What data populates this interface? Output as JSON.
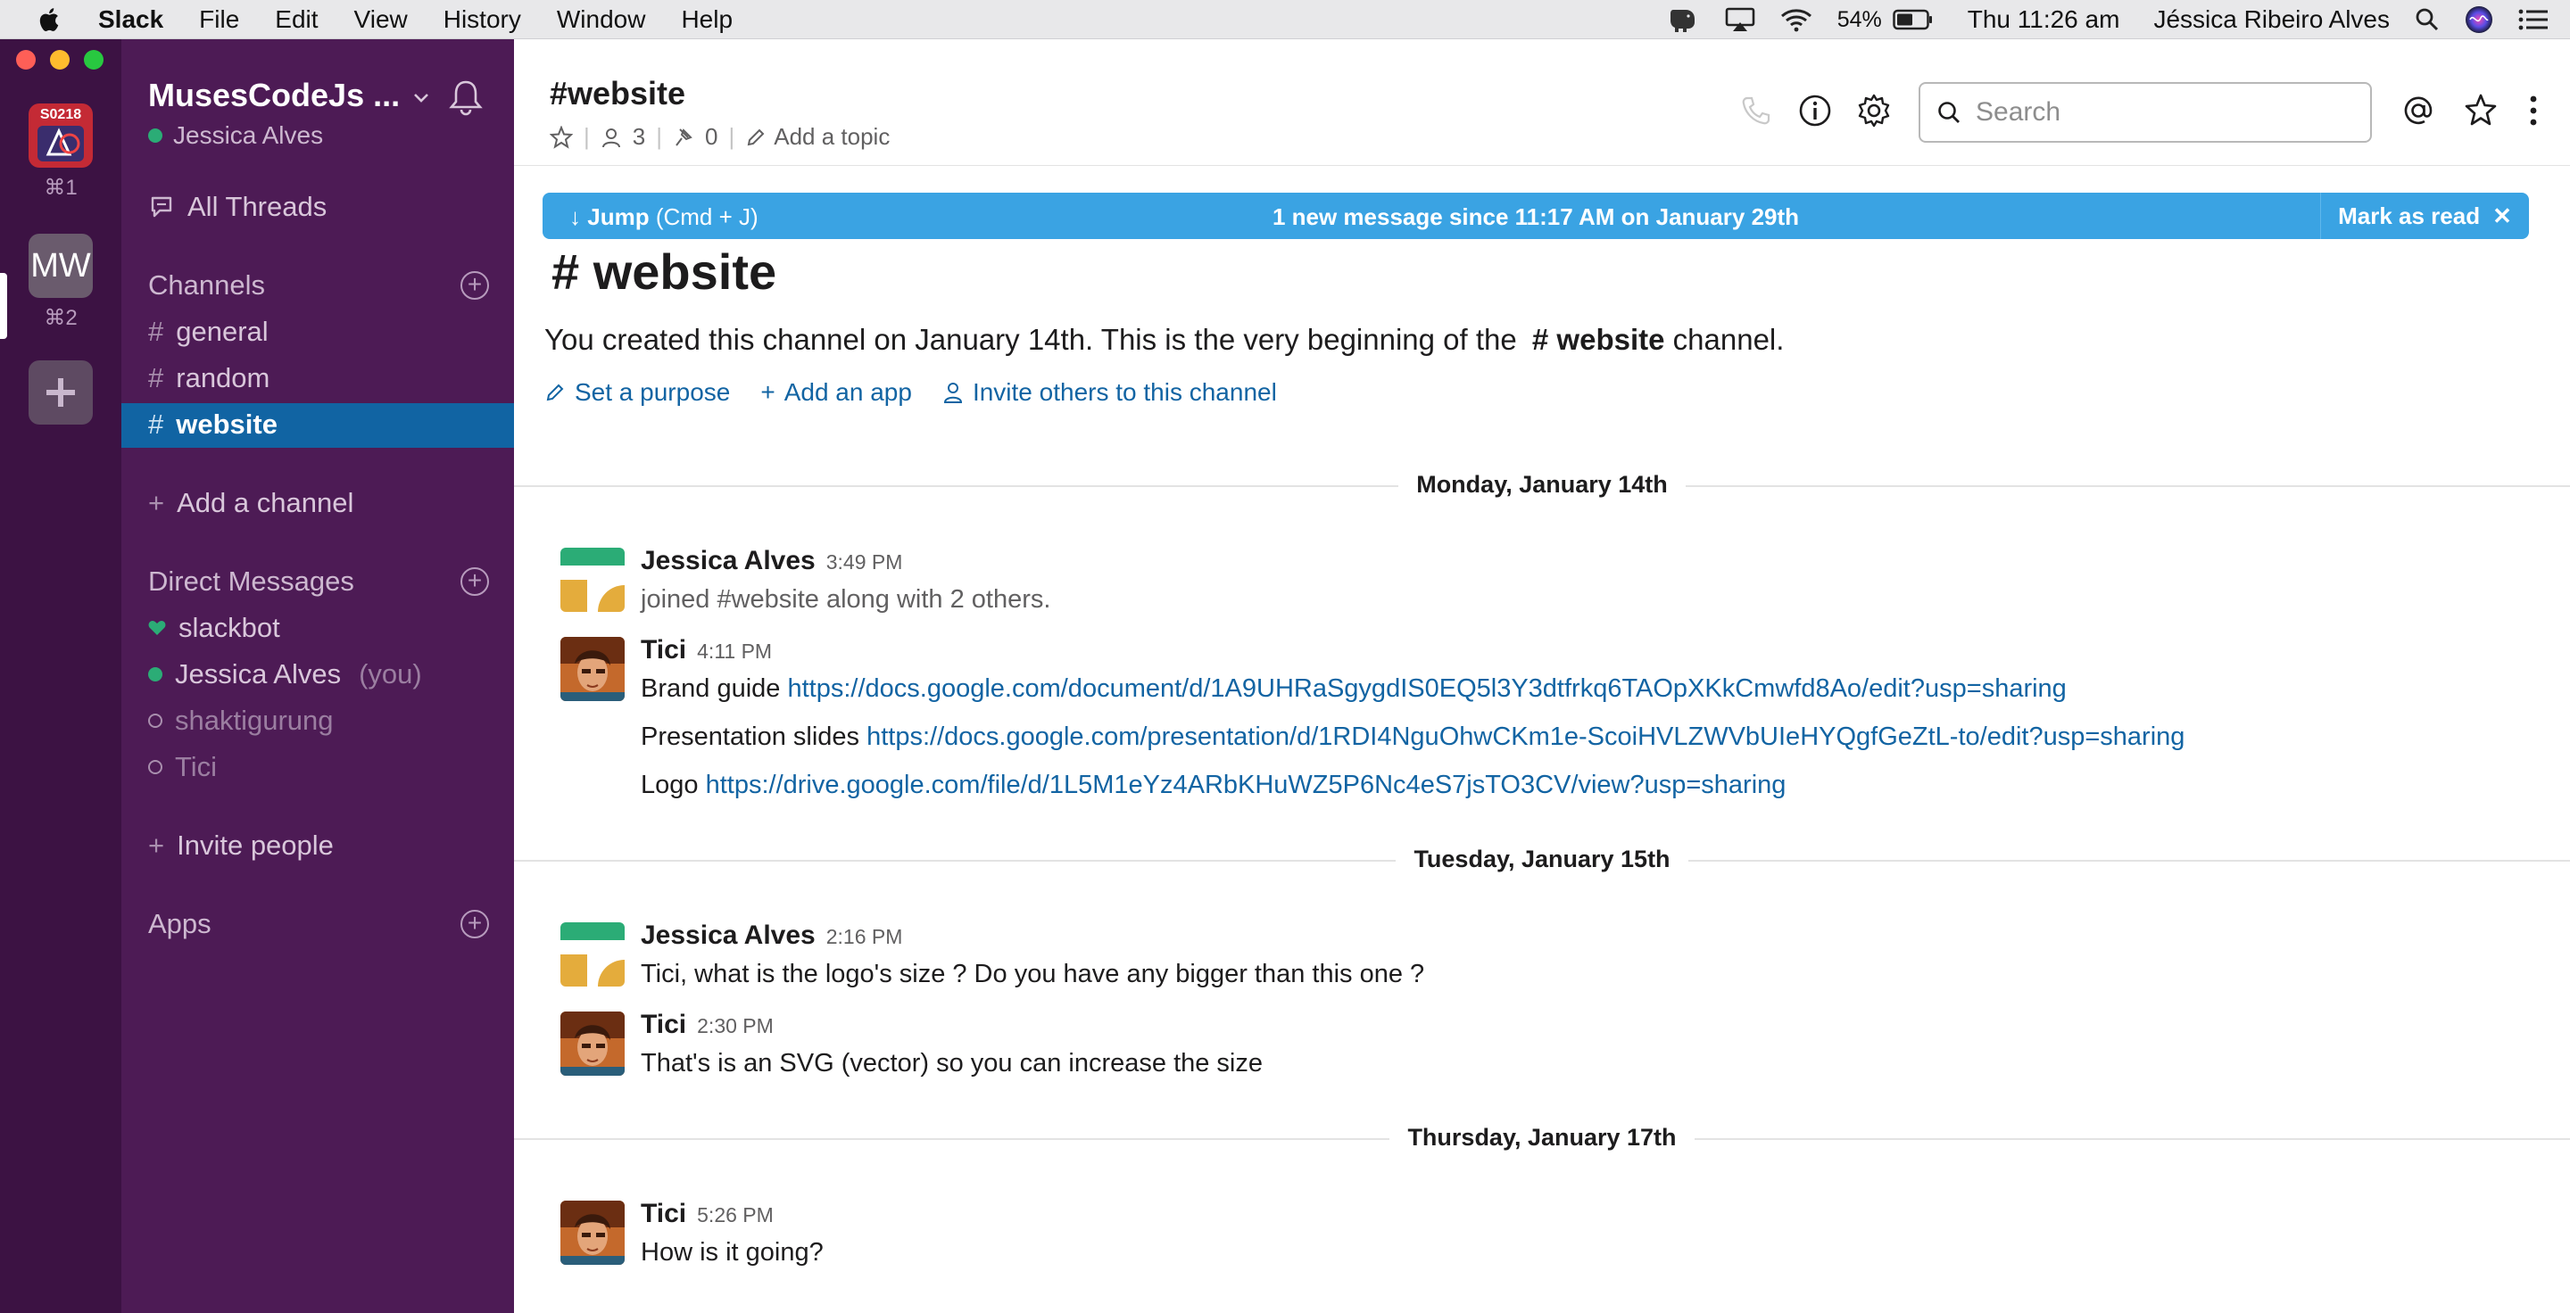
{
  "menubar": {
    "app": "Slack",
    "items": [
      "File",
      "Edit",
      "View",
      "History",
      "Window",
      "Help"
    ],
    "battery": "54%",
    "clock": "Thu 11:26 am",
    "user": "Jéssica Ribeiro Alves"
  },
  "switcher": {
    "workspaces": [
      {
        "badge": "S0218",
        "shortcut": "⌘1"
      },
      {
        "initials": "MW",
        "shortcut": "⌘2"
      }
    ],
    "add": "+"
  },
  "sidebar": {
    "team": "MusesCodeJs ...",
    "user": "Jessica Alves",
    "all_threads": "All Threads",
    "channels_label": "Channels",
    "channels": [
      "general",
      "random",
      "website"
    ],
    "add_channel": "Add a channel",
    "dm_label": "Direct Messages",
    "dms": [
      {
        "name": "slackbot",
        "suffix": ""
      },
      {
        "name": "Jessica Alves",
        "suffix": "(you)"
      },
      {
        "name": "shaktigurung",
        "suffix": ""
      },
      {
        "name": "Tici",
        "suffix": ""
      }
    ],
    "invite": "Invite people",
    "apps_label": "Apps"
  },
  "header": {
    "channel": "#website",
    "members": "3",
    "pins": "0",
    "add_topic": "Add a topic",
    "search_placeholder": "Search"
  },
  "banner": {
    "jump": "Jump",
    "jump_hint": "(Cmd + J)",
    "message": "1 new message since 11:17 AM on January 29th",
    "mark_read": "Mark as read"
  },
  "intro": {
    "title": "# website",
    "text_before": "You created this channel on January 14th. This is the very beginning of the",
    "channel": "# website",
    "text_after": "channel.",
    "set_purpose": "Set a purpose",
    "add_app": "Add an app",
    "invite": "Invite others to this channel"
  },
  "days": {
    "d1": "Monday, January 14th",
    "d2": "Tuesday, January 15th",
    "d3": "Thursday, January 17th"
  },
  "messages": {
    "m1": {
      "author": "Jessica Alves",
      "time": "3:49 PM",
      "text": "joined #website along with 2 others."
    },
    "m2": {
      "author": "Tici",
      "time": "4:11 PM",
      "l1_label": "Brand guide",
      "l1_url": "https://docs.google.com/document/d/1A9UHRaSgygdIS0EQ5l3Y3dtfrkq6TAOpXKkCmwfd8Ao/edit?usp=sharing",
      "l2_label": "Presentation slides",
      "l2_url": "https://docs.google.com/presentation/d/1RDI4NguOhwCKm1e-ScoiHVLZWVbUIeHYQgfGeZtL-to/edit?usp=sharing",
      "l3_label": "Logo",
      "l3_url": "https://drive.google.com/file/d/1L5M1eYz4ARbKHuWZ5P6Nc4eS7jsTO3CV/view?usp=sharing"
    },
    "m3": {
      "author": "Jessica Alves",
      "time": "2:16 PM",
      "text": "Tici, what is the logo's size ? Do you have any bigger than this one ?"
    },
    "m4": {
      "author": "Tici",
      "time": "2:30 PM",
      "text": "That's is an SVG (vector) so you can increase the size"
    },
    "m5": {
      "author": "Tici",
      "time": "5:26 PM",
      "text": "How is it going?"
    }
  }
}
